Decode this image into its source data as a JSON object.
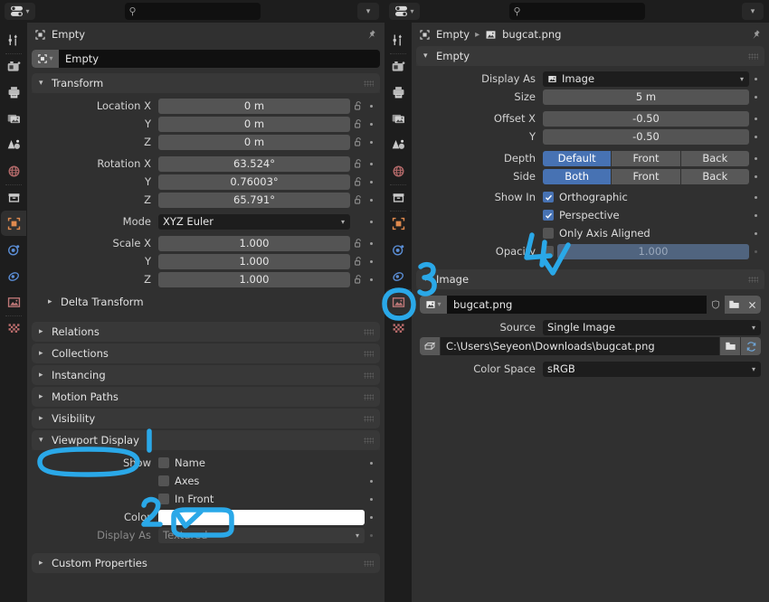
{
  "accent_blue": "#4772b3",
  "annotation_color": "#2aa8e8",
  "left_editor": {
    "header": {
      "editor_type_icon": "properties-editor-icon",
      "search_value": "",
      "search_placeholder": "",
      "options_chevron": "chevron-down-icon"
    },
    "tabs": [
      {
        "name": "tool",
        "icon": "tool-icon",
        "active": false
      },
      {
        "name": "render",
        "icon": "camera-back-icon",
        "active": false
      },
      {
        "name": "output",
        "icon": "printer-icon",
        "active": false
      },
      {
        "name": "view-layer",
        "icon": "images-icon",
        "active": false
      },
      {
        "name": "scene",
        "icon": "cone-sphere-icon",
        "active": false
      },
      {
        "name": "world",
        "icon": "world-icon",
        "active": false
      },
      {
        "name": "collection",
        "icon": "box-icon",
        "active": false
      },
      {
        "name": "object",
        "icon": "object-square-icon",
        "active": true
      },
      {
        "name": "modifiers",
        "icon": "physics-orbit-icon",
        "active": false
      },
      {
        "name": "physics",
        "icon": "physics-bounce-icon",
        "active": false
      },
      {
        "name": "object-data",
        "icon": "image-data-icon",
        "active": false
      },
      {
        "name": "texture",
        "icon": "checker-texture-icon",
        "active": false
      }
    ],
    "breadcrumb": {
      "items": [
        "Empty"
      ],
      "pin": "pin-icon"
    },
    "id_name": {
      "icon": "empty-axes-icon",
      "value": "Empty"
    },
    "transform": {
      "title": "Transform",
      "rows": [
        {
          "label": "Location X",
          "value": "0 m"
        },
        {
          "label": "Y",
          "value": "0 m"
        },
        {
          "label": "Z",
          "value": "0 m"
        },
        {
          "label": "Rotation X",
          "value": "63.524°"
        },
        {
          "label": "Y",
          "value": "0.76003°"
        },
        {
          "label": "Z",
          "value": "65.791°"
        }
      ],
      "mode": {
        "label": "Mode",
        "value": "XYZ Euler"
      },
      "scale": [
        {
          "label": "Scale X",
          "value": "1.000"
        },
        {
          "label": "Y",
          "value": "1.000"
        },
        {
          "label": "Z",
          "value": "1.000"
        }
      ]
    },
    "sub_panel": {
      "title": "Delta Transform"
    },
    "collapsed_panels": [
      {
        "title": "Relations"
      },
      {
        "title": "Collections"
      },
      {
        "title": "Instancing"
      },
      {
        "title": "Motion Paths"
      },
      {
        "title": "Visibility"
      }
    ],
    "viewport_display": {
      "title": "Viewport Display",
      "show_label": "Show",
      "checkboxes": [
        {
          "label": "Name",
          "checked": false
        },
        {
          "label": "Axes",
          "checked": false
        },
        {
          "label": "In Front",
          "checked": false
        }
      ],
      "color": {
        "label": "Color",
        "value": "#ffffff"
      },
      "display_as": {
        "label": "Display As",
        "value": "Textured",
        "disabled": true
      }
    },
    "custom_properties": {
      "title": "Custom Properties"
    }
  },
  "right_editor": {
    "header": {
      "editor_type_icon": "properties-editor-icon",
      "search_value": "",
      "search_placeholder": "",
      "options_chevron": "chevron-down-icon"
    },
    "tabs": [
      {
        "name": "tool",
        "icon": "tool-icon",
        "active": false
      },
      {
        "name": "render",
        "icon": "camera-back-icon",
        "active": false
      },
      {
        "name": "output",
        "icon": "printer-icon",
        "active": false
      },
      {
        "name": "view-layer",
        "icon": "images-icon",
        "active": false
      },
      {
        "name": "scene",
        "icon": "cone-sphere-icon",
        "active": false
      },
      {
        "name": "world",
        "icon": "world-icon",
        "active": false
      },
      {
        "name": "collection",
        "icon": "box-icon",
        "active": false
      },
      {
        "name": "object",
        "icon": "object-square-icon",
        "active": false
      },
      {
        "name": "modifiers",
        "icon": "physics-orbit-icon",
        "active": false
      },
      {
        "name": "physics",
        "icon": "physics-bounce-icon",
        "active": false
      },
      {
        "name": "object-data",
        "icon": "image-data-icon",
        "active": true
      },
      {
        "name": "texture",
        "icon": "checker-texture-icon",
        "active": false
      }
    ],
    "breadcrumb": {
      "item1": "Empty",
      "item2": "bugcat.png",
      "pin": "pin-icon"
    },
    "empty_panel": {
      "title": "Empty",
      "display_as": {
        "label": "Display As",
        "value": "Image"
      },
      "size": {
        "label": "Size",
        "value": "5 m"
      },
      "offset_x": {
        "label": "Offset X",
        "value": "-0.50"
      },
      "offset_y": {
        "label": "Y",
        "value": "-0.50"
      },
      "depth": {
        "label": "Depth",
        "options": [
          "Default",
          "Front",
          "Back"
        ],
        "selected": 0
      },
      "side": {
        "label": "Side",
        "options": [
          "Both",
          "Front",
          "Back"
        ],
        "selected": 0
      },
      "show_in_label": "Show In",
      "show_in": [
        {
          "label": "Orthographic",
          "checked": true
        },
        {
          "label": "Perspective",
          "checked": true
        },
        {
          "label": "Only Axis Aligned",
          "checked": false
        }
      ],
      "opacity": {
        "label": "Opacity",
        "checked": false,
        "value": "1.000"
      }
    },
    "image_panel": {
      "title": "Image",
      "datablock": {
        "icon": "image-icon",
        "name": "bugcat.png",
        "buttons": [
          "shield-fake-user-icon",
          "folder-open-icon",
          "close-x-icon"
        ]
      },
      "source": {
        "label": "Source",
        "value": "Single Image"
      },
      "filepath": {
        "icon": "file-path-icon",
        "value": "C:\\Users\\Seyeon\\Downloads\\bugcat.png",
        "buttons": [
          "folder-open-icon",
          "reload-icon"
        ]
      },
      "color_space": {
        "label": "Color Space",
        "value": "sRGB"
      }
    }
  },
  "annotations": [
    {
      "id": "1",
      "label": "1",
      "kind": "stroke"
    },
    {
      "id": "2",
      "label": "2",
      "kind": "digit"
    },
    {
      "id": "3",
      "label": "3",
      "kind": "digit"
    },
    {
      "id": "4",
      "label": "4",
      "kind": "digit"
    },
    {
      "id": "circle-viewport-display",
      "kind": "ellipse",
      "target": "Viewport Display"
    },
    {
      "id": "box-in-front",
      "kind": "rect",
      "target": "In Front"
    },
    {
      "id": "circle-object-data-tab",
      "kind": "ellipse",
      "target": "object-data tab"
    },
    {
      "id": "check-in-front",
      "kind": "check",
      "target": "In Front checkbox"
    },
    {
      "id": "check-opacity",
      "kind": "check",
      "target": "Opacity checkbox"
    }
  ]
}
